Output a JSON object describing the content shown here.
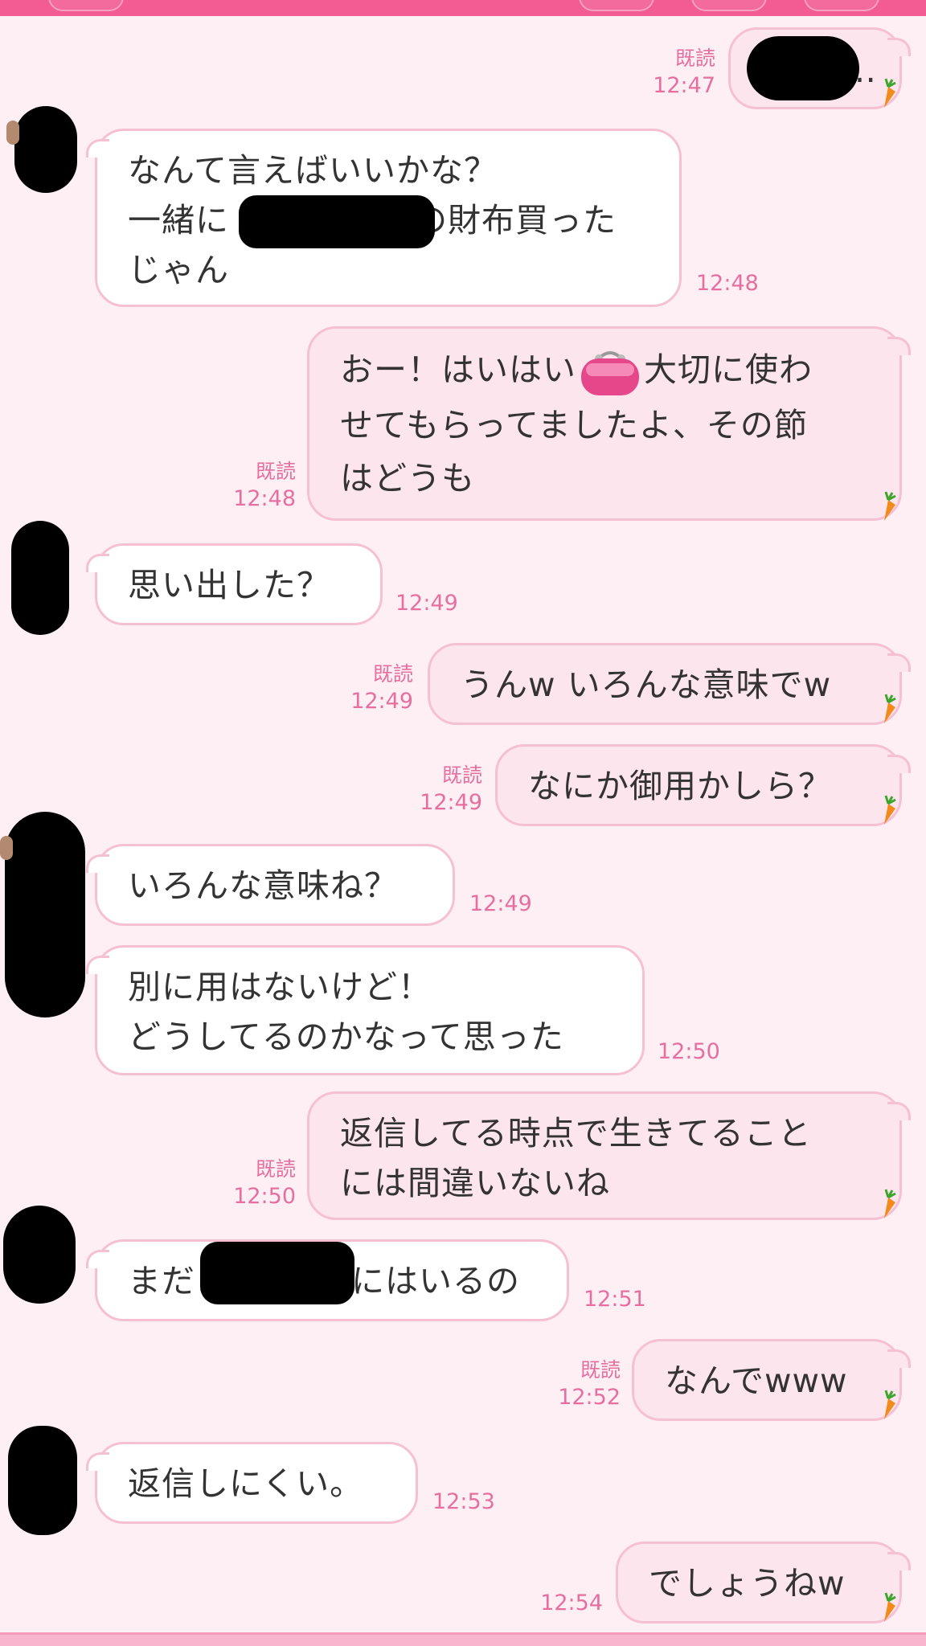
{
  "chat": {
    "colors": {
      "background": "#fdeff3",
      "header": "#f25c92",
      "timestamp": "#e76f9f",
      "bubble_border": "#f6c0d3",
      "out_bubble": "#fde5ee",
      "in_bubble": "#ffffff"
    },
    "read_label": "既読",
    "messages": [
      {
        "side": "out",
        "lines": [
          "…"
        ],
        "time": "12:47",
        "read": "既読"
      },
      {
        "side": "in",
        "lines": [
          "なんて言えばいいかな？",
          "一緒に",
          "の財布買った",
          "じゃん"
        ],
        "time": "12:48"
      },
      {
        "side": "out",
        "lines": [
          "おー！はいはい",
          "大切に使わ",
          "せてもらってましたよ、その節",
          "はどうも"
        ],
        "time": "12:48",
        "read": "既読",
        "emoji": "purse-icon"
      },
      {
        "side": "in",
        "lines": [
          "思い出した？"
        ],
        "time": "12:49"
      },
      {
        "side": "out",
        "lines": [
          "うんw いろんな意味でw"
        ],
        "time": "12:49",
        "read": "既読"
      },
      {
        "side": "out",
        "lines": [
          "なにか御用かしら？"
        ],
        "time": "12:49",
        "read": "既読"
      },
      {
        "side": "in",
        "lines": [
          "いろんな意味ね？"
        ],
        "time": "12:49"
      },
      {
        "side": "in",
        "lines": [
          "別に用はないけど！",
          "どうしてるのかなって思った"
        ],
        "time": "12:50"
      },
      {
        "side": "out",
        "lines": [
          "返信してる時点で生きてること",
          "には間違いないね"
        ],
        "time": "12:50",
        "read": "既読"
      },
      {
        "side": "in",
        "lines": [
          "まだ",
          "にはいるの"
        ],
        "time": "12:51"
      },
      {
        "side": "out",
        "lines": [
          "なんでwww"
        ],
        "time": "12:52",
        "read": "既読"
      },
      {
        "side": "in",
        "lines": [
          "返信しにくい。"
        ],
        "time": "12:53"
      },
      {
        "side": "out",
        "lines": [
          "でしょうねw"
        ],
        "time": "12:54"
      }
    ]
  }
}
